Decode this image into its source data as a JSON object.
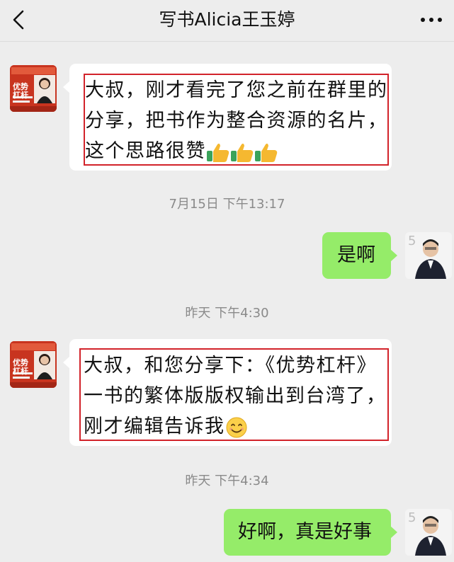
{
  "header": {
    "title": "写书Alicia王玉婷",
    "back_icon": "chevron-left-icon",
    "more_icon": "more-dots-icon"
  },
  "avatars": {
    "contact": {
      "text_top": "优势",
      "text_bottom": "杠杆",
      "color": "#c8341f"
    },
    "me": {
      "badge": "5"
    }
  },
  "messages": [
    {
      "side": "left",
      "lines": [
        "大叔，刚才看完了您之前在群里的",
        "分享，把书作为整合资源的名片，",
        "这个思路很赞"
      ],
      "emoji": [
        "thumbs-up-icon",
        "thumbs-up-icon",
        "thumbs-up-icon"
      ]
    },
    {
      "timestamp": "7月15日 下午13:17"
    },
    {
      "side": "right",
      "text": "是啊"
    },
    {
      "timestamp": "昨天 下午4:30"
    },
    {
      "side": "left",
      "lines": [
        "大叔，和您分享下：《优势杠杆》",
        "一书的繁体版版权输出到台湾了，",
        "刚才编辑告诉我"
      ],
      "emoji": [
        "smiling-face-icon"
      ]
    },
    {
      "timestamp": "昨天 下午4:34"
    },
    {
      "side": "right",
      "text": "好啊，真是好事"
    }
  ],
  "colors": {
    "background": "#ededed",
    "bubble_left": "#ffffff",
    "bubble_right": "#95ec69",
    "highlight_box": "#d2232a"
  }
}
